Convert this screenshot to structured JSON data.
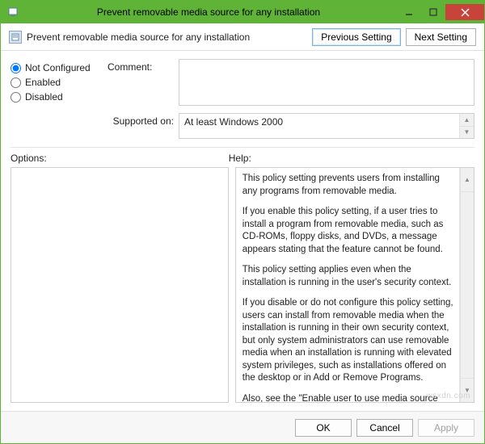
{
  "titlebar": {
    "title": "Prevent removable media source for any installation"
  },
  "subheader": {
    "title": "Prevent removable media source for any installation"
  },
  "nav": {
    "prev": "Previous Setting",
    "next": "Next Setting"
  },
  "state": {
    "not_configured": "Not Configured",
    "enabled": "Enabled",
    "disabled": "Disabled",
    "selected": "not_configured"
  },
  "form": {
    "comment_label": "Comment:",
    "comment_value": "",
    "supported_label": "Supported on:",
    "supported_value": "At least Windows 2000"
  },
  "sections": {
    "options": "Options:",
    "help": "Help:"
  },
  "help_paragraphs": [
    "This policy setting prevents users from installing any programs from removable media.",
    "If you enable this policy setting, if a user tries to install a program from removable media, such as CD-ROMs, floppy disks, and DVDs, a message appears stating that the feature cannot be found.",
    "This policy setting applies even when the installation is running in the user's security context.",
    "If you disable or do not configure this policy setting, users can install from removable media when the installation is running in their own security context, but only system administrators can use removable media when an installation is running with elevated system privileges, such as installations offered on the desktop or in Add or Remove Programs.",
    "Also, see the \"Enable user to use media source while elevated\" and \"Hide the 'Add a program from CD-ROM or floppy disk' option\" policy settings."
  ],
  "footer": {
    "ok": "OK",
    "cancel": "Cancel",
    "apply": "Apply"
  },
  "watermark": "wsxdn.com"
}
